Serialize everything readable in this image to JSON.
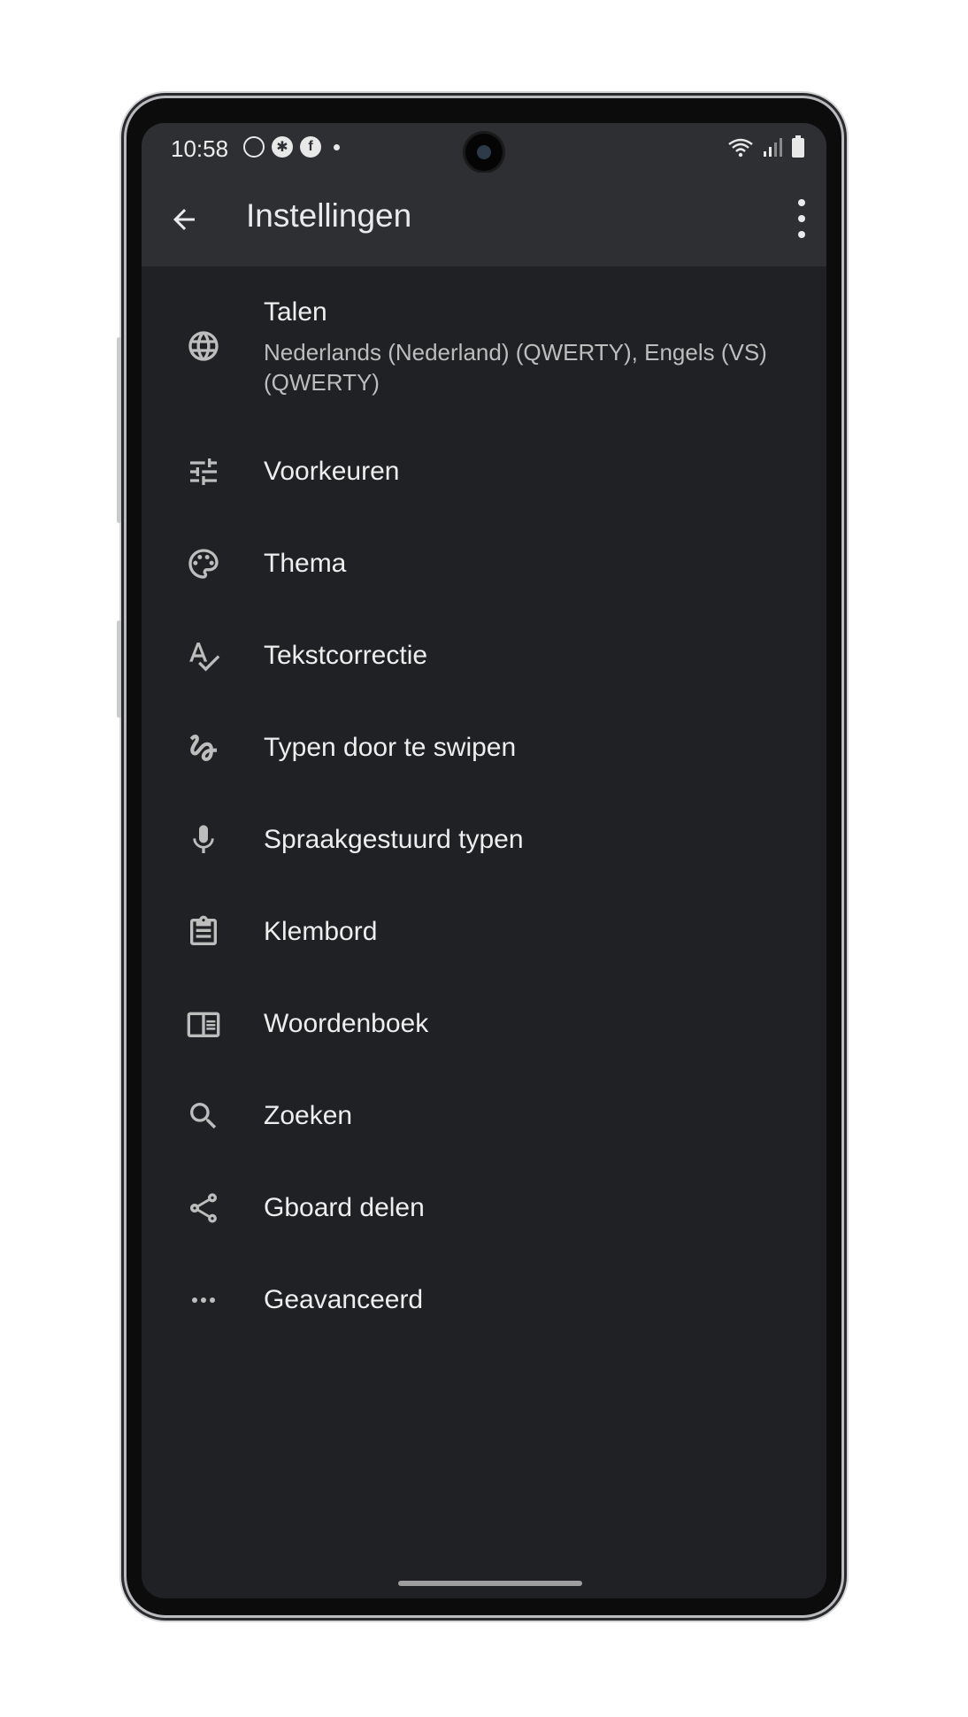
{
  "status_bar": {
    "time": "10:58",
    "notification_icons": [
      "watch-icon",
      "fitness-icon",
      "facebook-icon"
    ],
    "right_icons": [
      "wifi-icon",
      "signal-icon",
      "battery-icon"
    ]
  },
  "app_bar": {
    "title": "Instellingen",
    "back_icon": "arrow-back-icon",
    "menu_icon": "more-vert-icon"
  },
  "settings": {
    "items": [
      {
        "label": "Talen",
        "subtitle": "Nederlands (Nederland) (QWERTY), Engels (VS) (QWERTY)",
        "icon": "globe-icon"
      },
      {
        "label": "Voorkeuren",
        "icon": "tune-icon"
      },
      {
        "label": "Thema",
        "icon": "palette-icon"
      },
      {
        "label": "Tekstcorrectie",
        "icon": "spellcheck-icon"
      },
      {
        "label": "Typen door te swipen",
        "icon": "gesture-icon"
      },
      {
        "label": "Spraakgestuurd typen",
        "icon": "mic-icon"
      },
      {
        "label": "Klembord",
        "icon": "clipboard-icon"
      },
      {
        "label": "Woordenboek",
        "icon": "dictionary-icon"
      },
      {
        "label": "Zoeken",
        "icon": "search-icon"
      },
      {
        "label": "Gboard delen",
        "icon": "share-icon"
      },
      {
        "label": "Geavanceerd",
        "icon": "more-horiz-icon"
      }
    ]
  },
  "colors": {
    "background": "#202124",
    "app_bar": "#2e2f32",
    "text_primary": "#eeeeee",
    "text_secondary": "#bdbdbd",
    "icon": "#bdbdbd"
  }
}
